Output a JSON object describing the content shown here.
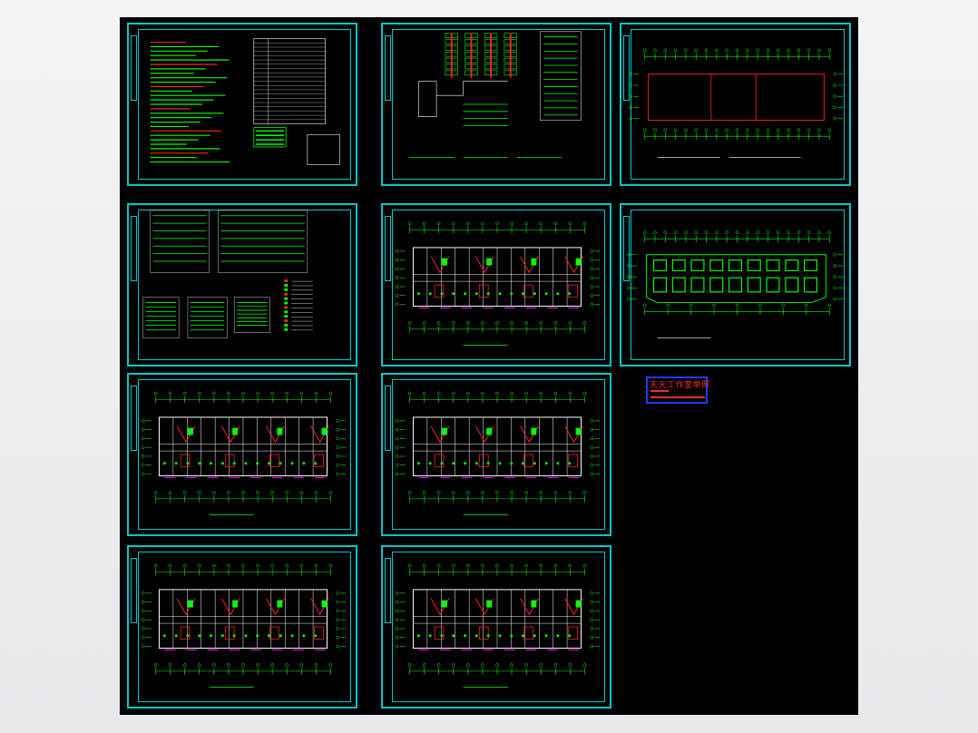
{
  "viewer": {
    "background_color": "#000000",
    "frame_color": "#00c8c8",
    "line_color": "#00ff00",
    "accent_color": "#ff2020",
    "magenta_color": "#ff00ff",
    "white_color": "#ffffff"
  },
  "sheets": [
    {
      "id": "design-notes",
      "kind": "notes-table"
    },
    {
      "id": "system-diagram",
      "kind": "riser"
    },
    {
      "id": "roof-plan",
      "kind": "roof"
    },
    {
      "id": "distribution-schedules",
      "kind": "schedules"
    },
    {
      "id": "floor-plan-a",
      "kind": "plan"
    },
    {
      "id": "foundation-plan",
      "kind": "foundation"
    },
    {
      "id": "floor-plan-b",
      "kind": "plan"
    },
    {
      "id": "floor-plan-c",
      "kind": "plan"
    },
    {
      "id": "floor-plan-d",
      "kind": "plan"
    },
    {
      "id": "floor-plan-e",
      "kind": "plan"
    }
  ],
  "stamp": {
    "title": "天天工作室举例",
    "border_color": "#1a3cff"
  }
}
